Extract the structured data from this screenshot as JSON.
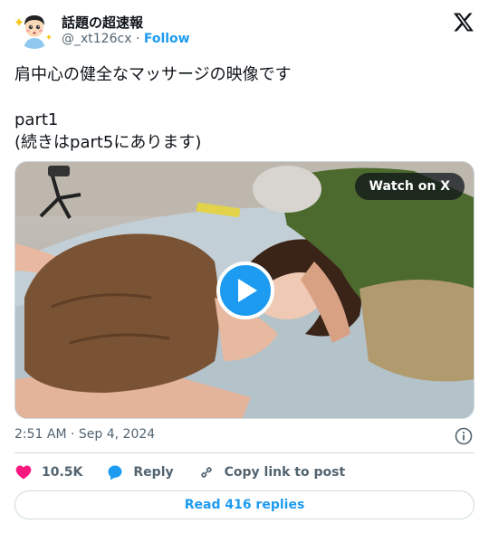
{
  "author": {
    "name": "話題の超速報",
    "handle": "@_xt126cx",
    "separator": "·",
    "follow_label": "Follow",
    "avatar_icon": "boy-face-avatar-icon"
  },
  "tweet": {
    "text": "肩中心の健全なマッサージの映像です\n\npart1\n(続きはpart5にあります)"
  },
  "media": {
    "watch_label": "Watch on X",
    "play_icon": "play-icon"
  },
  "meta": {
    "timestamp": "2:51 AM · Sep 4, 2024",
    "info_icon": "info-icon"
  },
  "actions": {
    "likes": "10.5K",
    "reply_label": "Reply",
    "copy_label": "Copy link to post"
  },
  "footer": {
    "read_replies_label": "Read 416 replies"
  },
  "colors": {
    "accent": "#1d9bf0",
    "like": "#f91880",
    "text": "#0f1419",
    "muted": "#536471",
    "border": "#cfd9de"
  }
}
